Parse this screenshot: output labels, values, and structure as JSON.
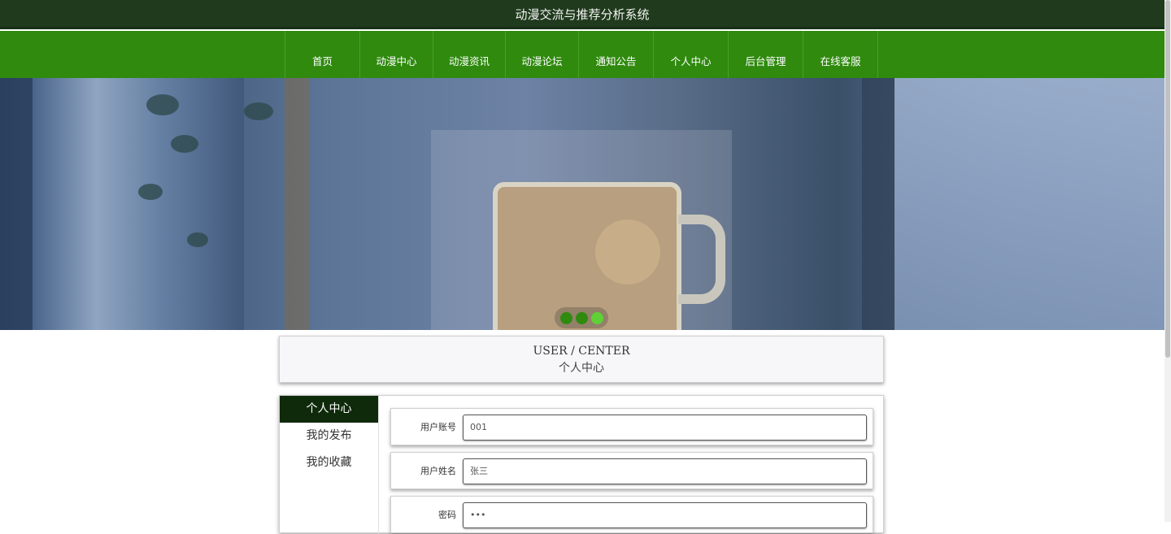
{
  "header": {
    "title": "动漫交流与推荐分析系统"
  },
  "nav": {
    "items": [
      {
        "label": "首页"
      },
      {
        "label": "动漫中心"
      },
      {
        "label": "动漫资讯"
      },
      {
        "label": "动漫论坛"
      },
      {
        "label": "通知公告"
      },
      {
        "label": "个人中心"
      },
      {
        "label": "后台管理"
      },
      {
        "label": "在线客服"
      }
    ]
  },
  "banner": {
    "slide_count": 3,
    "active_slide": 3
  },
  "center_header": {
    "en": "USER / CENTER",
    "zh": "个人中心"
  },
  "sidebar": {
    "items": [
      {
        "label": "个人中心",
        "active": true
      },
      {
        "label": "我的发布",
        "active": false
      },
      {
        "label": "我的收藏",
        "active": false
      }
    ]
  },
  "form": {
    "fields": [
      {
        "label": "用户账号",
        "value": "001"
      },
      {
        "label": "用户姓名",
        "value": "张三"
      },
      {
        "label": "密码",
        "value": "•••"
      }
    ]
  },
  "colors": {
    "nav_bg": "#2f8a0e",
    "topbar_bg": "#1f3a1c",
    "sidebar_active": "#0f2a0a",
    "dot_active": "#5fd035"
  }
}
